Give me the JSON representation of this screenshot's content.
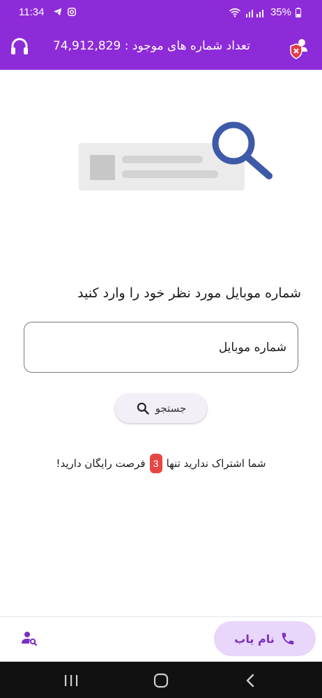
{
  "status_bar": {
    "time": "11:34",
    "battery": "35%"
  },
  "app_bar": {
    "title": "تعداد شماره های موجود : 74,912,829"
  },
  "main": {
    "prompt": "شماره موبایل مورد نظر خود را وارد کنید",
    "phone_placeholder": "شماره موبایل",
    "search_label": "جستجو",
    "quota_prefix": "شما اشتراک ندارید تنها",
    "quota_count": "3",
    "quota_suffix": "فرصت رایگان دارید!"
  },
  "bottom_nav": {
    "namyab_label": "نام یاب"
  },
  "colors": {
    "primary": "#8e2bd9",
    "accent_badge": "#e84545",
    "nav_pill": "#e9d6fb"
  }
}
